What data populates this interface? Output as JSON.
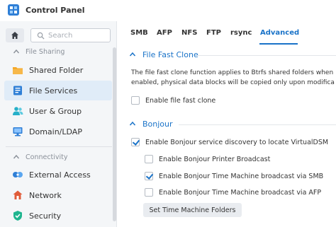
{
  "window": {
    "title": "Control Panel"
  },
  "sidebar": {
    "search_placeholder": "Search",
    "groups": [
      {
        "label": "File Sharing",
        "items": [
          {
            "label": "Shared Folder",
            "icon": "folder-icon"
          },
          {
            "label": "File Services",
            "icon": "file-services-icon",
            "active": true
          },
          {
            "label": "User & Group",
            "icon": "users-icon"
          },
          {
            "label": "Domain/LDAP",
            "icon": "domain-icon"
          }
        ]
      },
      {
        "label": "Connectivity",
        "items": [
          {
            "label": "External Access",
            "icon": "external-access-icon"
          },
          {
            "label": "Network",
            "icon": "network-icon"
          },
          {
            "label": "Security",
            "icon": "shield-icon"
          }
        ]
      }
    ]
  },
  "main": {
    "tabs": [
      "SMB",
      "AFP",
      "NFS",
      "FTP",
      "rsync",
      "Advanced"
    ],
    "active_tab": "Advanced",
    "fast_clone": {
      "title": "File Fast Clone",
      "desc_line1": "The file fast clone function applies to Btrfs shared folders when",
      "desc_line2": "enabled, physical data blocks will be copied only upon modifica",
      "enable_label": "Enable file fast clone",
      "enable_checked": false
    },
    "bonjour": {
      "title": "Bonjour",
      "enable_label": "Enable Bonjour service discovery to locate VirtualDSM",
      "enable_checked": true,
      "printer_label": "Enable Bonjour Printer Broadcast",
      "printer_checked": false,
      "tm_smb_label": "Enable Bonjour Time Machine broadcast via SMB",
      "tm_smb_checked": true,
      "tm_afp_label": "Enable Bonjour Time Machine broadcast via AFP",
      "tm_afp_checked": false,
      "tm_folders_button": "Set Time Machine Folders"
    }
  },
  "colors": {
    "accent": "#1a73c8",
    "active_bg": "#e0ecf8"
  }
}
